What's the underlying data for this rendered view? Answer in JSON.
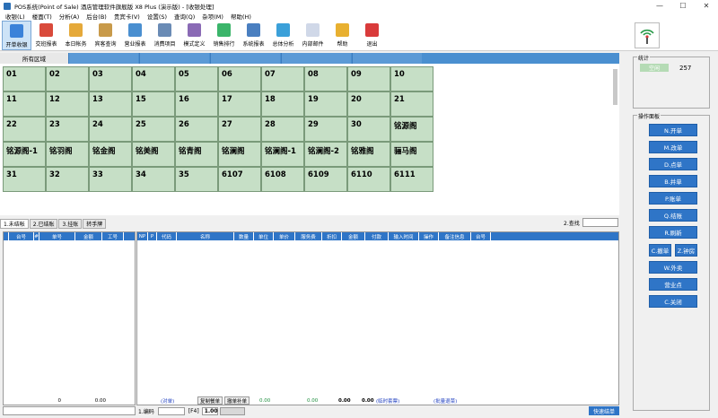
{
  "window": {
    "title": "POS系统(Point of Sale) 酒店管理软件旗舰版 X8 Plus (演示版) - [收银处理]",
    "min": "—",
    "max": "☐",
    "close": "✕"
  },
  "menu": [
    "收银(L)",
    "楼面(T)",
    "分析(A)",
    "后台(B)",
    "贵宾卡(V)",
    "设置(S)",
    "查询(Q)",
    "杂项(M)",
    "帮助(H)"
  ],
  "toolbar": [
    {
      "label": "开单收银",
      "color": "#3b82d9"
    },
    {
      "label": "交班报表",
      "color": "#d94a3b"
    },
    {
      "label": "本日帐务",
      "color": "#e5a93a"
    },
    {
      "label": "宾客查询",
      "color": "#c89a4a"
    },
    {
      "label": "营业报表",
      "color": "#4a8fd0"
    },
    {
      "label": "消费项目",
      "color": "#6a8bb5"
    },
    {
      "label": "模式定义",
      "color": "#8a6ab5"
    },
    {
      "label": "销售排行",
      "color": "#3bb56a"
    },
    {
      "label": "系统报表",
      "color": "#4a7fc0"
    },
    {
      "label": "总体分析",
      "color": "#3ba0d9"
    },
    {
      "label": "内部邮件",
      "color": "#d0d8e8"
    },
    {
      "label": "帮助",
      "color": "#e8b030"
    },
    {
      "label": "退出",
      "color": "#d93b3b"
    }
  ],
  "area_tabs": {
    "active": "所有区域"
  },
  "rooms": [
    "01",
    "02",
    "03",
    "04",
    "05",
    "06",
    "07",
    "08",
    "09",
    "10",
    "11",
    "12",
    "13",
    "15",
    "16",
    "17",
    "18",
    "19",
    "20",
    "21",
    "22",
    "23",
    "24",
    "25",
    "26",
    "27",
    "28",
    "29",
    "30",
    "铭源阁",
    "铭源阁-1",
    "铭羽阁",
    "铭金阁",
    "铭美阁",
    "铭青阁",
    "铭澜阁",
    "铭澜阁-1",
    "铭澜阁-2",
    "铭雅阁",
    "骊马阁",
    "31",
    "32",
    "33",
    "34",
    "35",
    "6107",
    "6108",
    "6109",
    "6110",
    "6111"
  ],
  "subtabs": [
    "1.未结帐",
    "2.已结账",
    "3.挂账",
    "转手牌"
  ],
  "search_label": "2.查找",
  "left_table": {
    "headers": [
      "台号",
      "#",
      "单号",
      "金额",
      "工号"
    ],
    "footer": {
      "count": "0",
      "amount": "0.00"
    }
  },
  "right_table": {
    "headers": [
      "NP",
      "P",
      "代码",
      "名称",
      "数量",
      "单位",
      "单价",
      "服务费",
      "折扣",
      "金额",
      "付款",
      "输入时间",
      "操作",
      "备注信息",
      "台号"
    ],
    "footer": {
      "p1": "(对单)",
      "v1": "0.00",
      "v2": "0.00",
      "v3": "0.00",
      "v4": "0.00",
      "note": "(临时套票)",
      "batch": "(批量退菜)"
    }
  },
  "bottom": {
    "code_label": "1.编码",
    "f4": "[F4]",
    "qty": "1.00",
    "copy_btn": "复制餐单",
    "undo_btn": "撤单补单",
    "quick_btn": "快速结单"
  },
  "stats": {
    "legend": "统计",
    "tag": "空闲",
    "value": "257"
  },
  "ops": {
    "legend": "操作面板",
    "open": "N.开单",
    "change": "M.改单",
    "order": "D.点单",
    "merge": "B.并单",
    "bill": "P.账单",
    "checkout": "Q.结账",
    "refresh": "R.刷新",
    "cancel": "C.撤单",
    "ztime": "Z.钟房",
    "takeout": "W.外卖",
    "revenue": "营业点",
    "close": "C.关闭"
  }
}
